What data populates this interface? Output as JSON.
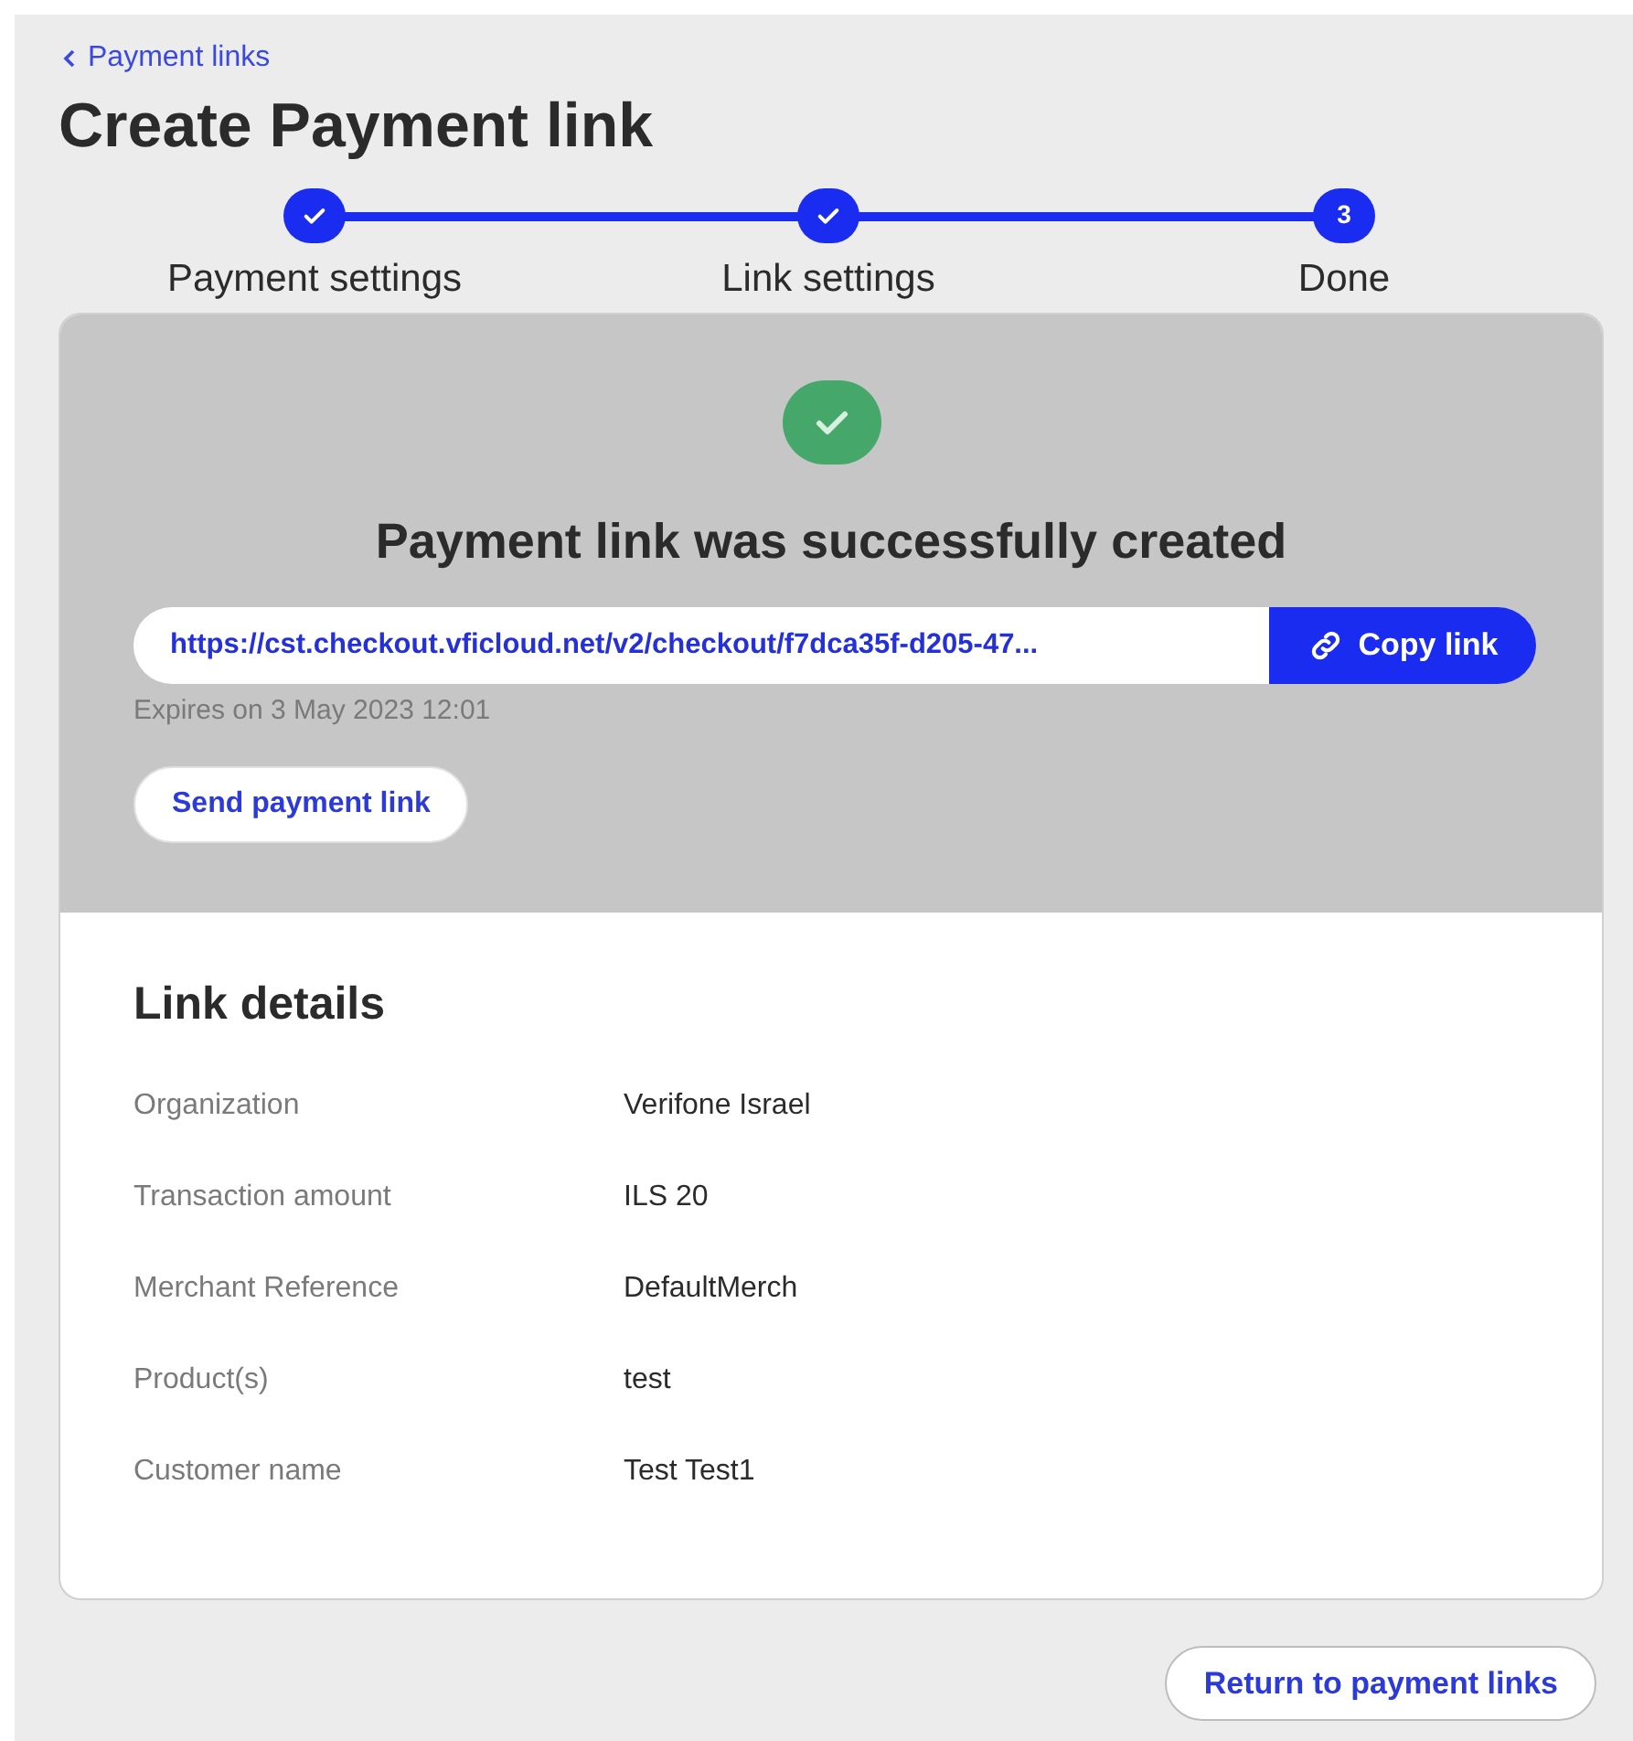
{
  "back_link": "Payment links",
  "title": "Create Payment link",
  "steps": [
    {
      "label": "Payment settings",
      "completed": true
    },
    {
      "label": "Link settings",
      "completed": true
    },
    {
      "label": "Done",
      "number": "3",
      "completed": false
    }
  ],
  "success": {
    "message": "Payment link was successfully created",
    "url": "https://cst.checkout.vficloud.net/v2/checkout/f7dca35f-d205-47...",
    "copy_button": "Copy link",
    "expires": "Expires on 3 May 2023 12:01",
    "send_button": "Send payment link"
  },
  "details": {
    "heading": "Link details",
    "rows": [
      {
        "label": "Organization",
        "value": "Verifone Israel"
      },
      {
        "label": "Transaction amount",
        "value": "ILS 20"
      },
      {
        "label": "Merchant Reference",
        "value": "DefaultMerch"
      },
      {
        "label": "Product(s)",
        "value": "test"
      },
      {
        "label": "Customer name",
        "value": "Test Test1"
      }
    ]
  },
  "return_button": "Return to payment links"
}
